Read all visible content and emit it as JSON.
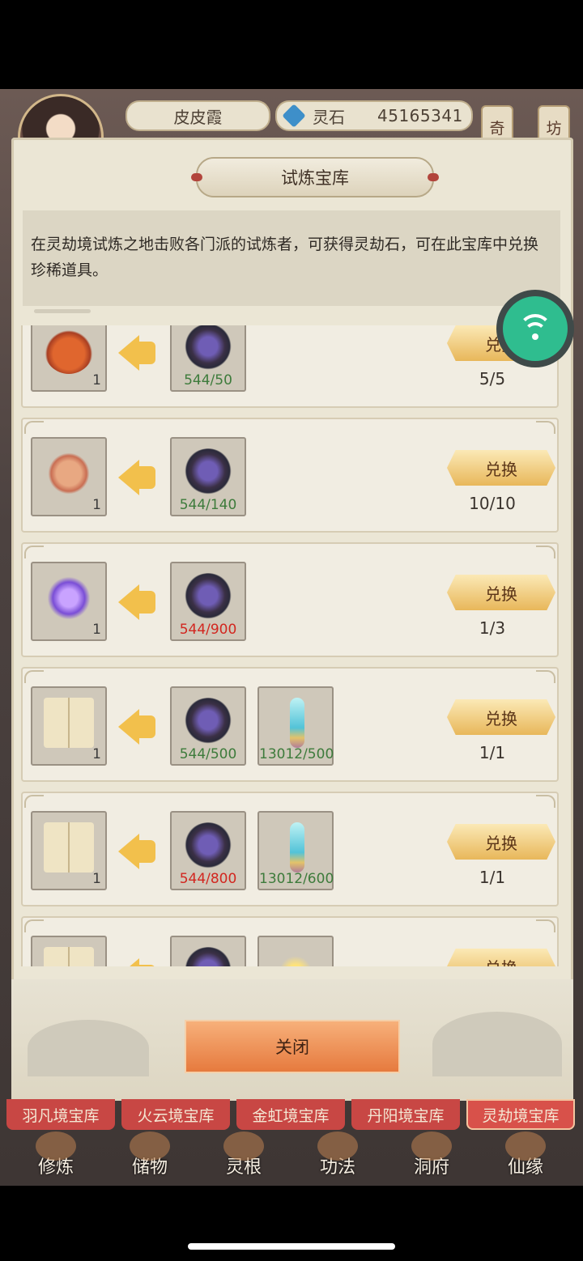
{
  "player": {
    "name": "皮皮霞",
    "currency_label": "灵石",
    "currency_value": "45165341"
  },
  "side_buttons": [
    "奇",
    "坊"
  ],
  "panel": {
    "title": "试炼宝库",
    "description": "在灵劫境试炼之地击败各门派的试炼者，可获得灵劫石，可在此宝库中兑换珍稀道具。",
    "exchange_label": "兑换",
    "close_label": "关闭"
  },
  "items": [
    {
      "icon": "gourd-icon",
      "qty": "1",
      "costs": [
        {
          "icon": "spirit-stone-icon",
          "text": "544/50",
          "ok": true
        }
      ],
      "limit": "5/5"
    },
    {
      "icon": "scroll-icon",
      "qty": "1",
      "costs": [
        {
          "icon": "spirit-stone-icon",
          "text": "544/140",
          "ok": true
        }
      ],
      "limit": "10/10"
    },
    {
      "icon": "crystal-icon",
      "qty": "1",
      "costs": [
        {
          "icon": "spirit-stone-icon",
          "text": "544/900",
          "ok": false
        }
      ],
      "limit": "1/3"
    },
    {
      "icon": "book-icon",
      "qty": "1",
      "costs": [
        {
          "icon": "spirit-stone-icon",
          "text": "544/500",
          "ok": true
        },
        {
          "icon": "sword-icon",
          "text": "13012/500",
          "ok": true
        }
      ],
      "limit": "1/1"
    },
    {
      "icon": "book-icon",
      "qty": "1",
      "costs": [
        {
          "icon": "spirit-stone-icon",
          "text": "544/800",
          "ok": false
        },
        {
          "icon": "sword-icon",
          "text": "13012/600",
          "ok": true
        }
      ],
      "limit": "1/1"
    },
    {
      "icon": "book-icon",
      "qty": "",
      "costs": [
        {
          "icon": "spirit-stone-icon",
          "text": "",
          "ok": true
        },
        {
          "icon": "flame-icon",
          "text": "",
          "ok": true
        }
      ],
      "limit": ""
    }
  ],
  "tabs": [
    {
      "label": "羽凡境宝库",
      "active": false
    },
    {
      "label": "火云境宝库",
      "active": false
    },
    {
      "label": "金虹境宝库",
      "active": false
    },
    {
      "label": "丹阳境宝库",
      "active": false
    },
    {
      "label": "灵劫境宝库",
      "active": true
    }
  ],
  "nav": [
    "修炼",
    "储物",
    "灵根",
    "功法",
    "洞府",
    "仙缘"
  ],
  "colors": {
    "ok": "#3d7b3b",
    "bad": "#d2261f",
    "tab": "#c84744",
    "button": "#e8b75a"
  }
}
